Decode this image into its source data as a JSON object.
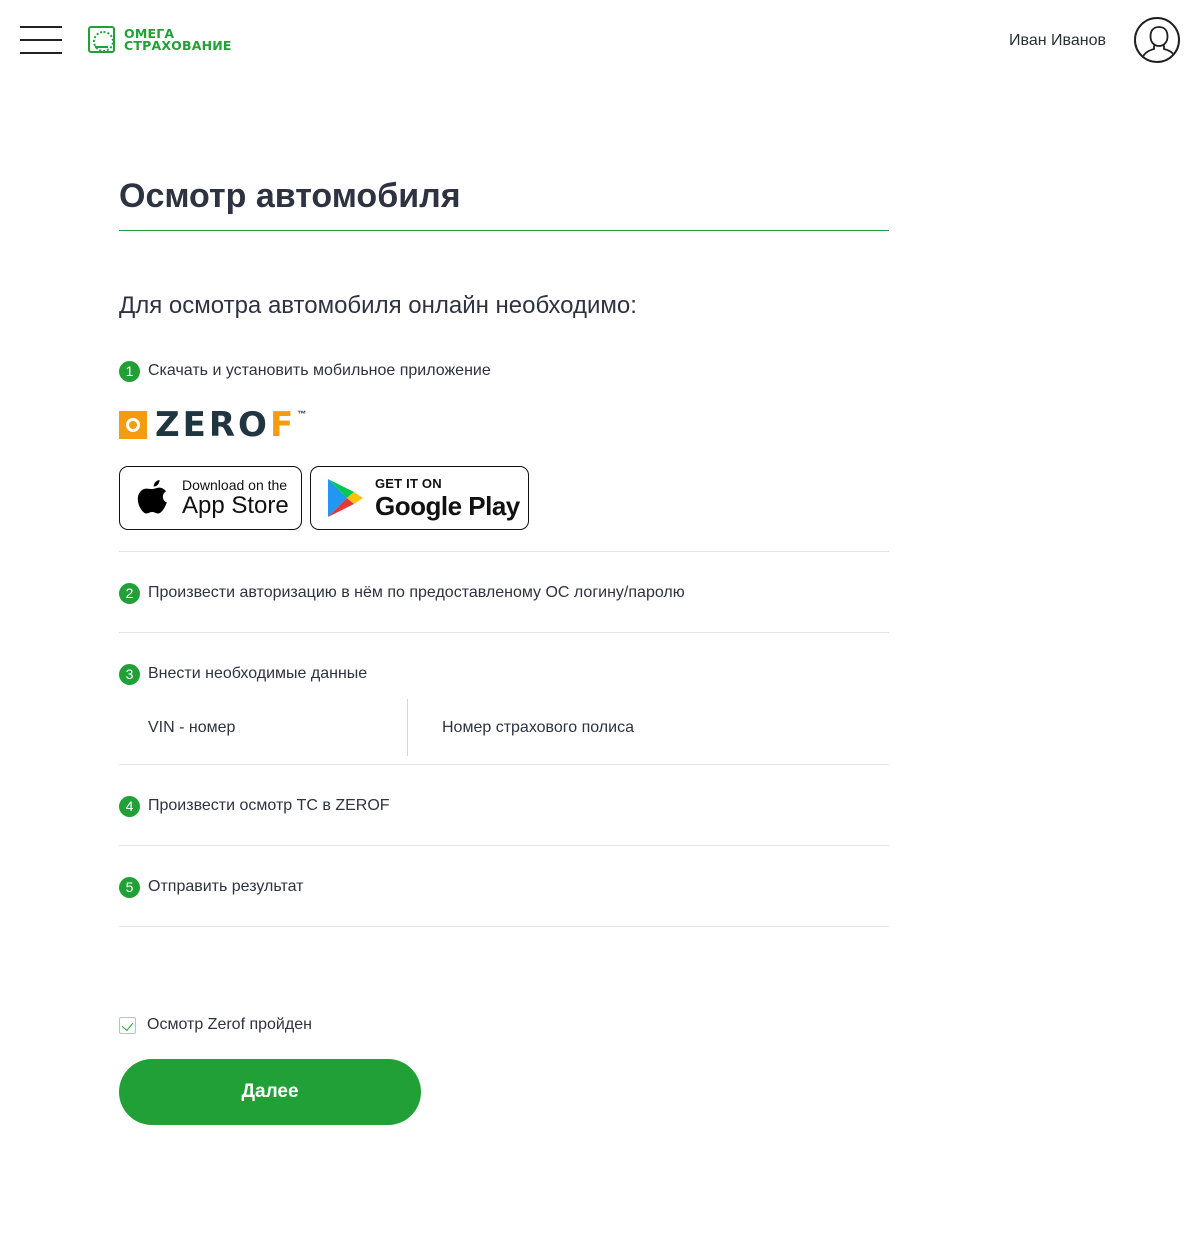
{
  "header": {
    "logo_line1": "ОМЕГА",
    "logo_line2": "СТРАХОВАНИЕ",
    "user_name": "Иван Иванов"
  },
  "main": {
    "title": "Осмотр автомобиля",
    "intro": "Для осмотра автомобиля онлайн необходимо:",
    "steps": [
      {
        "number": "1",
        "text": "Скачать и установить мобильное приложение"
      },
      {
        "number": "2",
        "text": "Произвести авторизацию в нём по предоставленому ОС логину/паролю"
      },
      {
        "number": "3",
        "text": "Внести необходимые данные"
      },
      {
        "number": "4",
        "text": "Произвести осмотр ТС в ZEROF"
      },
      {
        "number": "5",
        "text": "Отправить результат"
      }
    ],
    "zerof_logo": {
      "word": "ZERO",
      "last_letter": "F",
      "tm": "™"
    },
    "app_store": {
      "small": "Download on the",
      "big": "App Store"
    },
    "google_play": {
      "small": "GET IT ON",
      "big": "Google Play"
    },
    "fields": {
      "vin_placeholder": "VIN - номер",
      "policy_placeholder": "Номер страхового полиса"
    },
    "confirm_label": "Осмотр Zerof пройден",
    "confirm_checked": true,
    "next_button": "Далее"
  },
  "colors": {
    "brand_green": "#21a038",
    "zerof_orange": "#f39c12",
    "zerof_navy": "#1f3540",
    "text": "#2d3340"
  },
  "icons": [
    "menu-icon",
    "user-avatar-icon",
    "apple-icon",
    "google-play-icon",
    "checkmark-icon"
  ]
}
